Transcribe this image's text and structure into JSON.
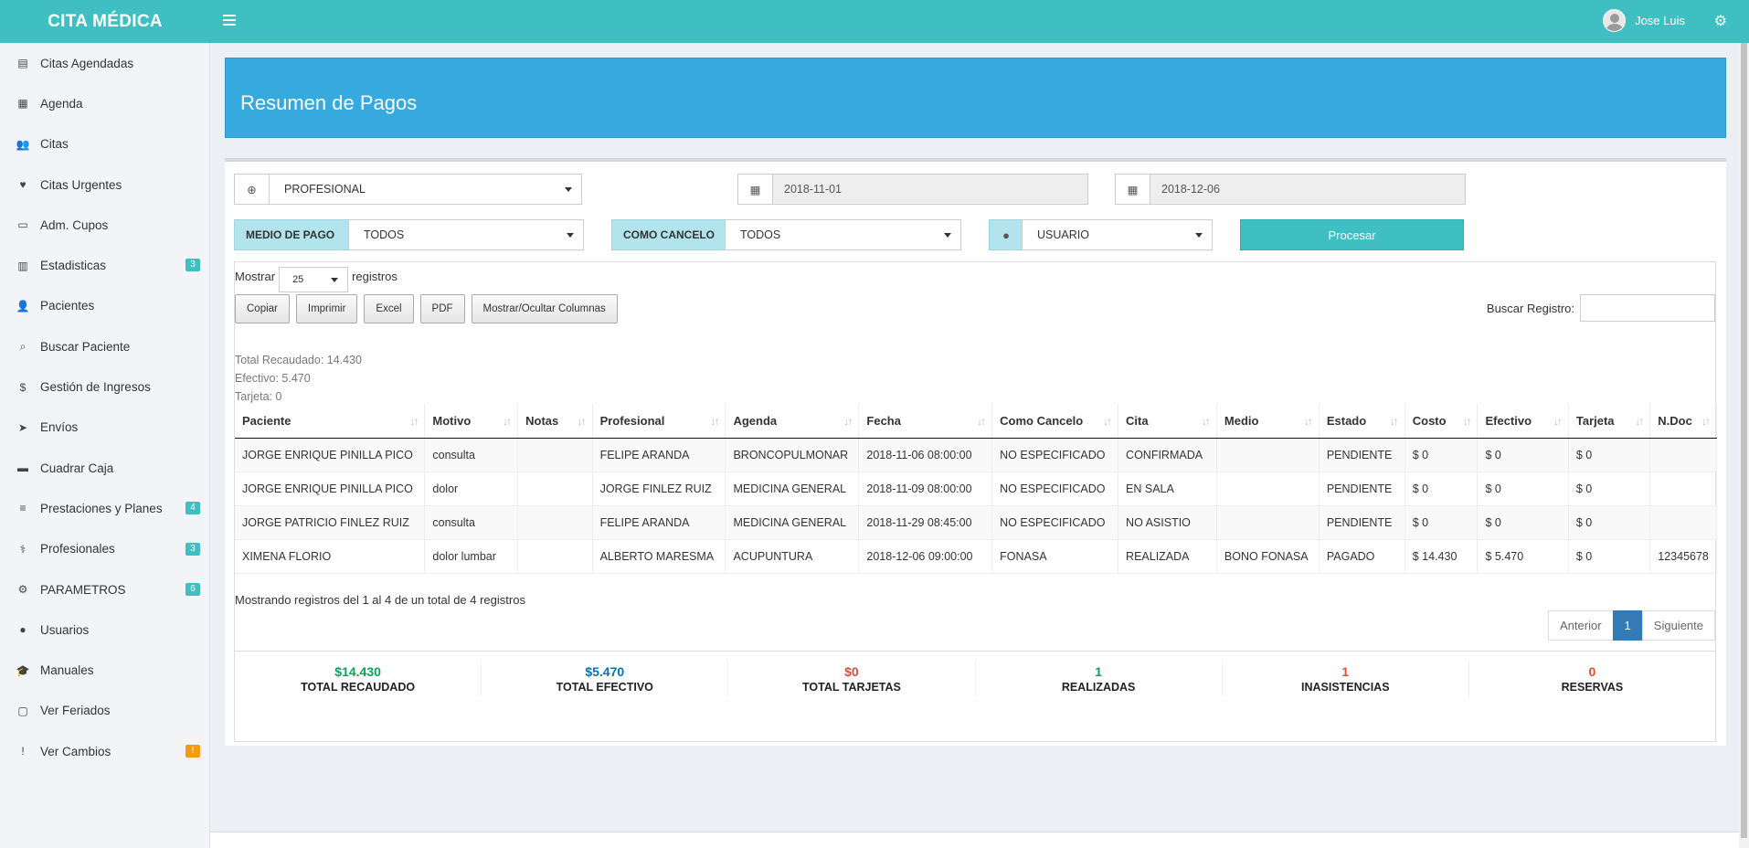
{
  "app": {
    "brand": "CITA MÉDICA",
    "user_name": "Jose Luis"
  },
  "sidebar": {
    "items": [
      {
        "label": "Citas Agendadas",
        "icon": "book-icon",
        "glyph": "▤",
        "badge": ""
      },
      {
        "label": "Agenda",
        "icon": "calendar-icon",
        "glyph": "▦",
        "badge": ""
      },
      {
        "label": "Citas",
        "icon": "users-icon",
        "glyph": "👥",
        "badge": ""
      },
      {
        "label": "Citas Urgentes",
        "icon": "heartbeat-icon",
        "glyph": "♥",
        "badge": ""
      },
      {
        "label": "Adm. Cupos",
        "icon": "list-alt-icon",
        "glyph": "▭",
        "badge": ""
      },
      {
        "label": "Estadisticas",
        "icon": "bar-chart-icon",
        "glyph": "▥",
        "badge": "3"
      },
      {
        "label": "Pacientes",
        "icon": "user-plus-icon",
        "glyph": "👤",
        "badge": ""
      },
      {
        "label": "Buscar Paciente",
        "icon": "search-icon",
        "glyph": "⌕",
        "badge": ""
      },
      {
        "label": "Gestión de Ingresos",
        "icon": "dollar-icon",
        "glyph": "$",
        "badge": ""
      },
      {
        "label": "Envíos",
        "icon": "paper-plane-icon",
        "glyph": "➤",
        "badge": ""
      },
      {
        "label": "Cuadrar Caja",
        "icon": "credit-card-icon",
        "glyph": "▬",
        "badge": ""
      },
      {
        "label": "Prestaciones y Planes",
        "icon": "bars-icon",
        "glyph": "≡",
        "badge": "4"
      },
      {
        "label": "Profesionales",
        "icon": "user-md-icon",
        "glyph": "⚕",
        "badge": "3"
      },
      {
        "label": "PARAMETROS",
        "icon": "cogs-icon",
        "glyph": "⚙",
        "badge": "6"
      },
      {
        "label": "Usuarios",
        "icon": "user-icon",
        "glyph": "●",
        "badge": ""
      },
      {
        "label": "Manuales",
        "icon": "graduation-cap-icon",
        "glyph": "🎓",
        "badge": ""
      },
      {
        "label": "Ver Feriados",
        "icon": "calendar-o-icon",
        "glyph": "▢",
        "badge": ""
      },
      {
        "label": "Ver Cambios",
        "icon": "exclamation-circle-icon",
        "glyph": "!",
        "badge": "!"
      }
    ]
  },
  "page": {
    "title": "Resumen de Pagos"
  },
  "filters": {
    "profesional": "PROFESIONAL",
    "date_from": "2018-11-01",
    "date_to": "2018-12-06",
    "medio_label": "MEDIO DE PAGO",
    "medio_value": "TODOS",
    "cancelo_label": "COMO CANCELO",
    "cancelo_value": "TODOS",
    "usuario_value": "USUARIO",
    "process_label": "Procesar"
  },
  "table_controls": {
    "show_label": "Mostrar",
    "show_value": "25",
    "records_label": "registros",
    "buttons": [
      "Copiar",
      "Imprimir",
      "Excel",
      "PDF",
      "Mostrar/Ocultar Columnas"
    ],
    "search_label": "Buscar Registro:"
  },
  "summary_text": {
    "total": "Total Recaudado: 14.430",
    "efectivo": "Efectivo: 5.470",
    "tarjeta": "Tarjeta: 0"
  },
  "table": {
    "columns": [
      "Paciente",
      "Motivo",
      "Notas",
      "Profesional",
      "Agenda",
      "Fecha",
      "Como Cancelo",
      "Cita",
      "Medio",
      "Estado",
      "Costo",
      "Efectivo",
      "Tarjeta",
      "N.Doc"
    ],
    "rows": [
      [
        "JORGE ENRIQUE PINILLA PICO",
        "consulta",
        "",
        "FELIPE ARANDA",
        "BRONCOPULMONAR",
        "2018-11-06 08:00:00",
        "NO ESPECIFICADO",
        "CONFIRMADA",
        "",
        "PENDIENTE",
        "$ 0",
        "$ 0",
        "$ 0",
        ""
      ],
      [
        "JORGE ENRIQUE PINILLA PICO",
        "dolor",
        "",
        "JORGE FINLEZ RUIZ",
        "MEDICINA GENERAL",
        "2018-11-09 08:00:00",
        "NO ESPECIFICADO",
        "EN SALA",
        "",
        "PENDIENTE",
        "$ 0",
        "$ 0",
        "$ 0",
        ""
      ],
      [
        "JORGE PATRICIO FINLEZ RUIZ",
        "consulta",
        "",
        "FELIPE ARANDA",
        "MEDICINA GENERAL",
        "2018-11-29 08:45:00",
        "NO ESPECIFICADO",
        "NO ASISTIO",
        "",
        "PENDIENTE",
        "$ 0",
        "$ 0",
        "$ 0",
        ""
      ],
      [
        "XIMENA FLORIO",
        "dolor lumbar",
        "",
        "ALBERTO MARESMA",
        "ACUPUNTURA",
        "2018-12-06 09:00:00",
        "FONASA",
        "REALIZADA",
        "BONO FONASA",
        "PAGADO",
        "$ 14.430",
        "$ 5.470",
        "$ 0",
        "12345678"
      ]
    ]
  },
  "info_text": "Mostrando registros del 1 al 4 de un total de 4 registros",
  "pager": {
    "prev": "Anterior",
    "current": "1",
    "next": "Siguiente"
  },
  "stats": [
    {
      "value": "$14.430",
      "label": "TOTAL RECAUDADO",
      "color": "#00a65a"
    },
    {
      "value": "$5.470",
      "label": "TOTAL EFECTIVO",
      "color": "#0073b7"
    },
    {
      "value": "$0",
      "label": "TOTAL TARJETAS",
      "color": "#dd4b39"
    },
    {
      "value": "1",
      "label": "REALIZADAS",
      "color": "#00a65a"
    },
    {
      "value": "1",
      "label": "INASISTENCIAS",
      "color": "#dd4b39"
    },
    {
      "value": "0",
      "label": "RESERVAS",
      "color": "#dd4b39"
    }
  ]
}
